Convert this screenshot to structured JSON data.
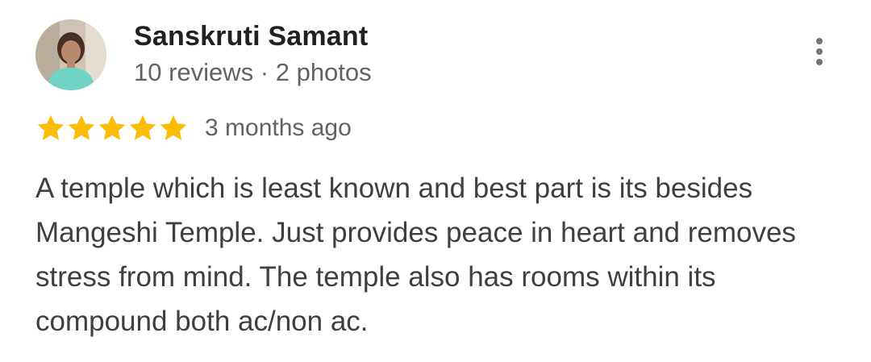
{
  "reviewer": {
    "name": "Sanskruti Samant",
    "meta": "10 reviews · 2 photos"
  },
  "rating": {
    "stars": 5,
    "max_stars": 5,
    "star_color": "#fbbc04",
    "date": "3 months ago"
  },
  "review": {
    "text": "A temple which is least known and best part is its besides Mangeshi Temple. Just provides peace in heart and removes stress from mind. The temple also has rooms within its compound both ac/non ac."
  },
  "icons": {
    "more": "more-vert-icon",
    "star": "star-icon"
  }
}
